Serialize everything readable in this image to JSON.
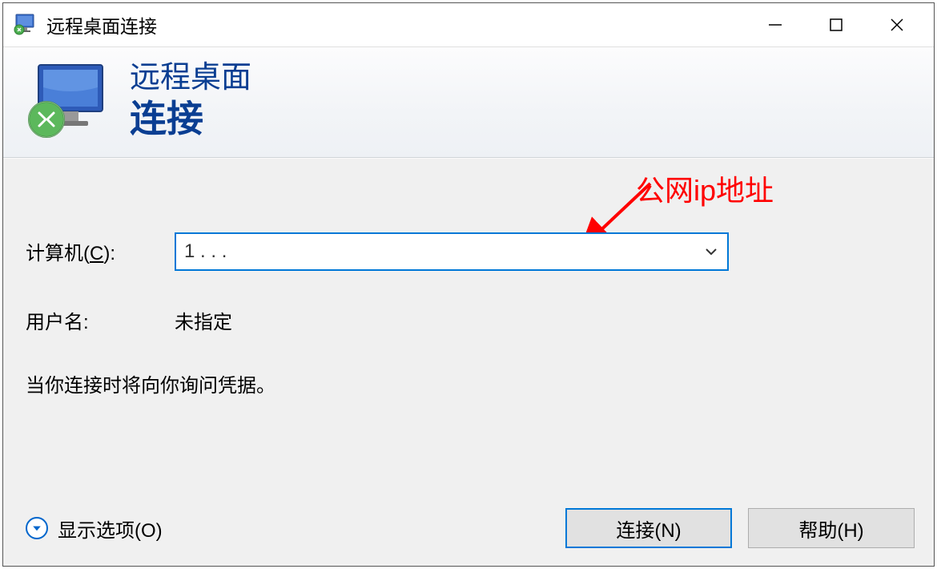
{
  "titlebar": {
    "title": "远程桌面连接"
  },
  "header": {
    "line1": "远程桌面",
    "line2": "连接"
  },
  "form": {
    "computer_label_prefix": "计算机(",
    "computer_label_key": "C",
    "computer_label_suffix": "):",
    "computer_value": "1  . . .",
    "username_label": "用户名:",
    "username_value": "未指定",
    "info_text": "当你连接时将向你询问凭据。"
  },
  "footer": {
    "expand_label_prefix": "显示选项(",
    "expand_label_key": "O",
    "expand_label_suffix": ")",
    "connect_label": "连接(N)",
    "help_label": "帮助(H)"
  },
  "annotation": {
    "text": "公网ip地址"
  }
}
